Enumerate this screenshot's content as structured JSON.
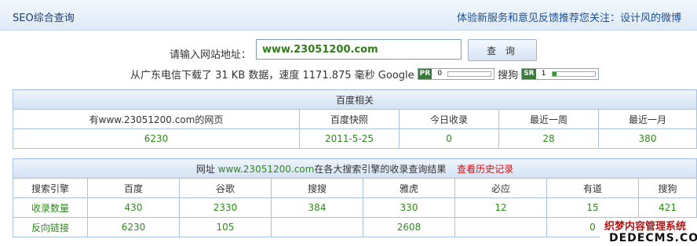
{
  "topbar": {
    "title": "SEO综合查询",
    "links": "体验新服务和意见反馈推荐您关注：设计风的微博"
  },
  "query": {
    "label": "请输入网站地址：",
    "input_value": "www.23051200.com",
    "button_label": "查 询"
  },
  "download": {
    "text": "从广东电信下载了 31 KB 数据，速度 1171.875 毫秒 Google",
    "pr_tag": "PR",
    "pr_value": "0",
    "sogou_label": "搜狗",
    "sr_tag": "SR",
    "sr_value": "1",
    "sr_fraction": 0.1
  },
  "baidu": {
    "header": "百度相关",
    "labels": [
      "有www.23051200.com的网页",
      "百度快照",
      "今日收录",
      "最近一周",
      "最近一月"
    ],
    "values": [
      "6230",
      "2011-5-25",
      "0",
      "28",
      "380"
    ]
  },
  "engines": {
    "header_prefix": "网址 ",
    "header_domain": "www.23051200.com",
    "header_suffix": "在各大搜索引擎的收录查询结果",
    "history_link": "查看历史记录",
    "columns": [
      "搜索引擎",
      "百度",
      "谷歌",
      "搜搜",
      "雅虎",
      "必应",
      "有道",
      "搜狗"
    ],
    "row_index": {
      "label": "收录数量",
      "values": [
        "430",
        "2330",
        "384",
        "330",
        "12",
        "15",
        "421"
      ]
    },
    "row_backlinks": {
      "label": "反向链接",
      "values": [
        "6230",
        "105",
        "",
        "2608",
        "",
        "0",
        ""
      ]
    }
  },
  "watermark": {
    "line1": "织梦内容管理系统",
    "line2": "DEDECMS.COM"
  }
}
